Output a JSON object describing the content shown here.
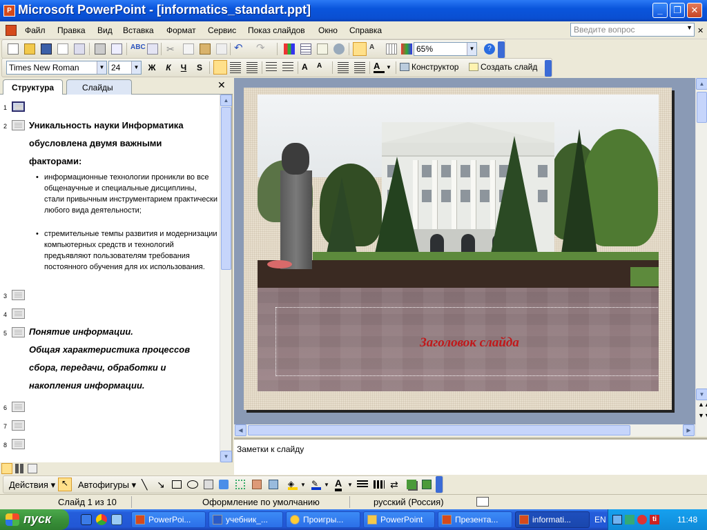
{
  "window": {
    "title": "Microsoft PowerPoint - [informatics_standart.ppt]",
    "app_icon": "P",
    "minimize": "_",
    "maximize": "❐",
    "close": "✕"
  },
  "menu": {
    "items": [
      "Файл",
      "Правка",
      "Вид",
      "Вставка",
      "Формат",
      "Сервис",
      "Показ слайдов",
      "Окно",
      "Справка"
    ],
    "ask_placeholder": "Введите вопрос"
  },
  "standard_toolbar": {
    "zoom": "65%"
  },
  "format_toolbar": {
    "font": "Times New Roman",
    "size": "24",
    "bold": "Ж",
    "italic": "К",
    "underline": "Ч",
    "shadow": "S",
    "designer": "Конструктор",
    "new_slide": "Создать слайд"
  },
  "left_panel": {
    "tab_outline": "Структура",
    "tab_slides": "Слайды",
    "close": "✕",
    "slides": [
      {
        "num": "1"
      },
      {
        "num": "2",
        "title_lines": [
          "Уникальность науки Информатика",
          "обусловлена двумя важными",
          "факторами:"
        ],
        "bullets": [
          "информационные технологии проникли во все общенаучные и специальные дисциплины, стали привычным инструментарием практически любого вида деятельности;",
          "стремительные темпы развития и модернизации компьютерных  средств и технологий предъявляют пользователям требования постоянного обучения для их использования."
        ]
      },
      {
        "num": "3"
      },
      {
        "num": "4"
      },
      {
        "num": "5",
        "title_lines": [
          "Понятие информации.",
          "Общая характеристика процессов",
          "сбора, передачи, обработки и",
          "накопления информации."
        ]
      },
      {
        "num": "6"
      },
      {
        "num": "7"
      },
      {
        "num": "8"
      }
    ]
  },
  "slide": {
    "placeholder_title": "Заголовок слайда"
  },
  "notes": {
    "placeholder": "Заметки к слайду"
  },
  "drawing_toolbar": {
    "actions": "Действия",
    "autoshapes": "Автофигуры"
  },
  "status": {
    "slide_counter": "Слайд 1 из 10",
    "design": "Оформление по умолчанию",
    "language": "русский (Россия)"
  },
  "taskbar": {
    "start": "пуск",
    "tasks": [
      "PowerPoi...",
      "учебник_...",
      "Проигры...",
      "PowerPoint",
      "Презента...",
      "informati..."
    ],
    "tray_lang": "EN",
    "clock": "11:48"
  },
  "colors": {
    "title_red": "#c0181a",
    "xp_blue": "#0a55dc",
    "start_green": "#3a913a"
  }
}
